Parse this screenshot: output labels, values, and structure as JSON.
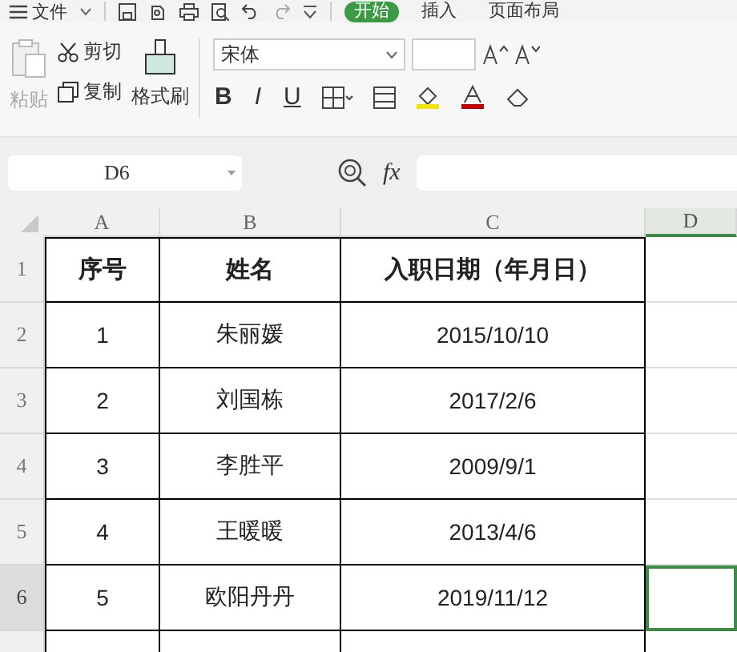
{
  "menu": {
    "file": "文件",
    "tabs": [
      {
        "label": "开始",
        "selected": true
      },
      {
        "label": "插入",
        "selected": false
      },
      {
        "label": "页面布局",
        "selected": false
      }
    ]
  },
  "clipboard": {
    "paste": "粘贴",
    "paste_disabled": true,
    "cut": "剪切",
    "copy": "复制",
    "format_painter": "格式刷"
  },
  "font": {
    "name": "宋体",
    "bold": "B",
    "italic": "I",
    "underline": "U"
  },
  "formula_bar": {
    "cell": "D6",
    "fx": "fx"
  },
  "sheet": {
    "columns": [
      {
        "label": "A",
        "selected": false
      },
      {
        "label": "B",
        "selected": false
      },
      {
        "label": "C",
        "selected": false
      },
      {
        "label": "D",
        "selected": true
      }
    ],
    "rows": [
      {
        "number": "1",
        "kind": "header",
        "selected": false,
        "cells": [
          "序号",
          "姓名",
          "入职日期（年月日）"
        ]
      },
      {
        "number": "2",
        "kind": "data",
        "selected": false,
        "cells": [
          "1",
          "朱丽媛",
          "2015/10/10"
        ]
      },
      {
        "number": "3",
        "kind": "data",
        "selected": false,
        "cells": [
          "2",
          "刘国栋",
          "2017/2/6"
        ]
      },
      {
        "number": "4",
        "kind": "data",
        "selected": false,
        "cells": [
          "3",
          "李胜平",
          "2009/9/1"
        ]
      },
      {
        "number": "5",
        "kind": "data",
        "selected": false,
        "cells": [
          "4",
          "王暖暖",
          "2013/4/6"
        ]
      },
      {
        "number": "6",
        "kind": "data",
        "selected": true,
        "cells": [
          "5",
          "欧阳丹丹",
          "2019/11/12"
        ]
      }
    ]
  }
}
